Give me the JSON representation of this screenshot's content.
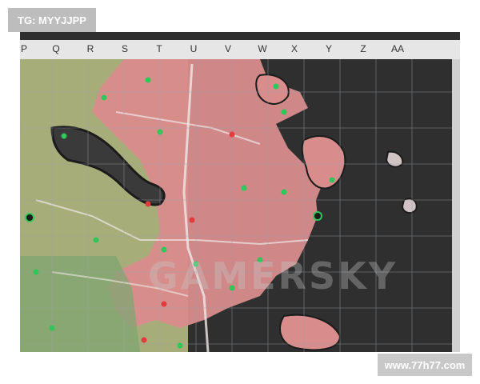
{
  "overlay": {
    "tg_label": "TG: MYYJJPP",
    "site_label": "www.77h77.com",
    "map_watermark": "GAMERSKY"
  },
  "map": {
    "grid_columns": [
      "P",
      "Q",
      "R",
      "S",
      "T",
      "U",
      "V",
      "W",
      "X",
      "Y",
      "Z",
      "AA"
    ],
    "colors": {
      "ocean": "#2f2f2f",
      "land_west": "#a7ad78",
      "land_red": "#d98c8c",
      "coast": "#1b1b1b",
      "grid": "#9aa0a6",
      "road": "#f0e8e8",
      "marker_green": "#31c65a",
      "marker_red": "#e33b3b"
    }
  }
}
